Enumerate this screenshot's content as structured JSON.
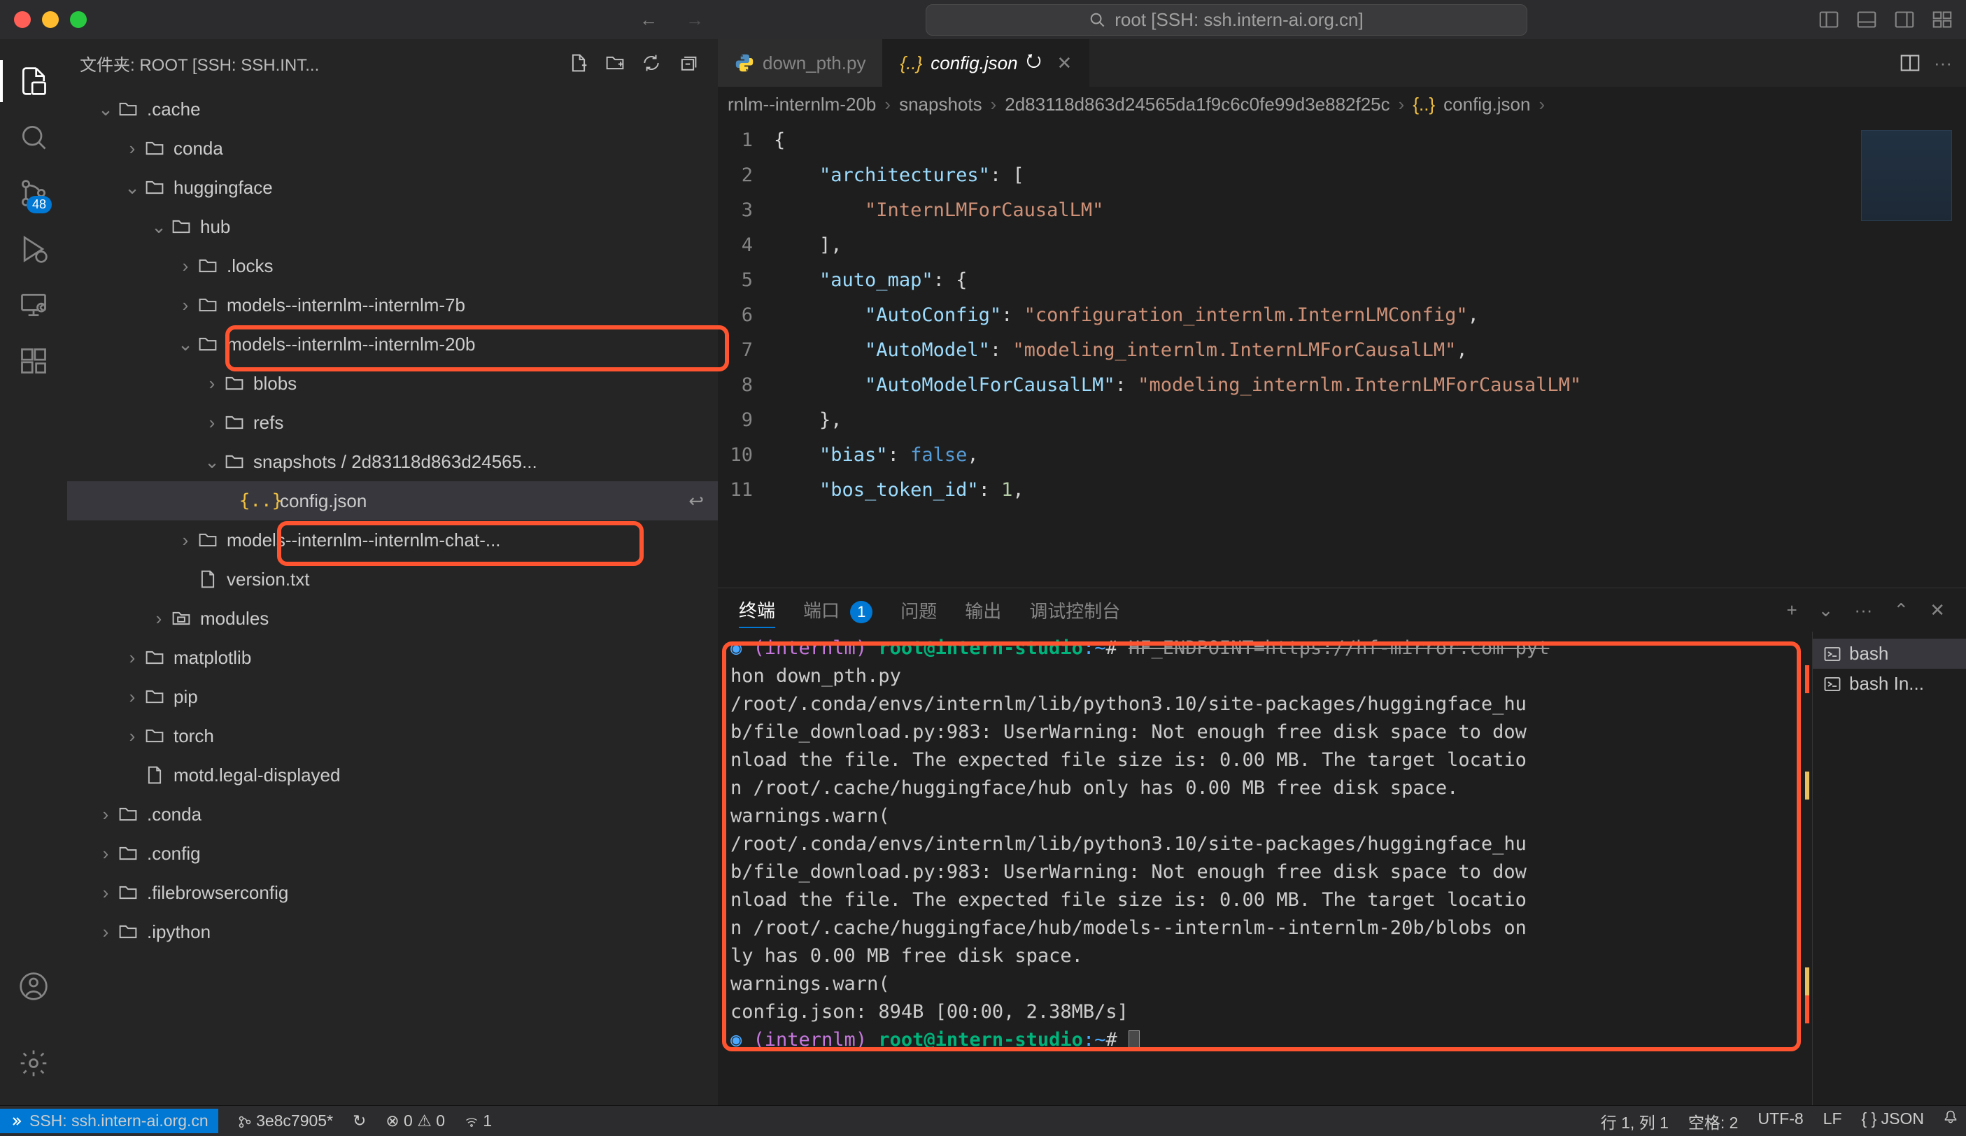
{
  "titlebar": {
    "title": "root [SSH: ssh.intern-ai.org.cn]"
  },
  "activity": {
    "badge": "48"
  },
  "sidebar": {
    "header": "文件夹: ROOT [SSH: SSH.INT...",
    "tree": [
      {
        "indent": 0,
        "chev": "down",
        "icon": "folder-open",
        "label": ".cache"
      },
      {
        "indent": 1,
        "chev": "right",
        "icon": "folder",
        "label": "conda"
      },
      {
        "indent": 1,
        "chev": "down",
        "icon": "folder-open",
        "label": "huggingface"
      },
      {
        "indent": 2,
        "chev": "down",
        "icon": "folder-open",
        "label": "hub"
      },
      {
        "indent": 3,
        "chev": "right",
        "icon": "folder",
        "label": ".locks"
      },
      {
        "indent": 3,
        "chev": "right",
        "icon": "folder",
        "label": "models--internlm--internlm-7b"
      },
      {
        "indent": 3,
        "chev": "down",
        "icon": "folder-open",
        "label": "models--internlm--internlm-20b"
      },
      {
        "indent": 4,
        "chev": "right",
        "icon": "folder",
        "label": "blobs"
      },
      {
        "indent": 4,
        "chev": "right",
        "icon": "folder",
        "label": "refs"
      },
      {
        "indent": 4,
        "chev": "down",
        "icon": "folder-open",
        "label": "snapshots / 2d83118d863d24565..."
      },
      {
        "indent": 5,
        "chev": "",
        "icon": "json",
        "label": "config.json",
        "selected": true,
        "return": true
      },
      {
        "indent": 3,
        "chev": "right",
        "icon": "folder",
        "label": "models--internlm--internlm-chat-..."
      },
      {
        "indent": 3,
        "chev": "",
        "icon": "file",
        "label": "version.txt"
      },
      {
        "indent": 2,
        "chev": "right",
        "icon": "folder-modules",
        "label": "modules"
      },
      {
        "indent": 1,
        "chev": "right",
        "icon": "folder",
        "label": "matplotlib"
      },
      {
        "indent": 1,
        "chev": "right",
        "icon": "folder",
        "label": "pip"
      },
      {
        "indent": 1,
        "chev": "right",
        "icon": "folder",
        "label": "torch"
      },
      {
        "indent": 1,
        "chev": "",
        "icon": "file",
        "label": "motd.legal-displayed"
      },
      {
        "indent": 0,
        "chev": "right",
        "icon": "folder",
        "label": ".conda"
      },
      {
        "indent": 0,
        "chev": "right",
        "icon": "folder",
        "label": ".config"
      },
      {
        "indent": 0,
        "chev": "right",
        "icon": "folder",
        "label": ".filebrowserconfig"
      },
      {
        "indent": 0,
        "chev": "right",
        "icon": "folder",
        "label": ".ipython"
      }
    ]
  },
  "editor": {
    "tabs": [
      {
        "icon": "python",
        "label": "down_pth.py",
        "active": false,
        "dirty": false
      },
      {
        "icon": "json",
        "label": "config.json",
        "active": true,
        "dirty": true,
        "italic": true
      }
    ],
    "breadcrumbs": [
      "rnlm--internlm-20b",
      "snapshots",
      "2d83118d863d24565da1f9c6c0fe99d3e882f25c",
      "config.json"
    ],
    "code": {
      "lines": [
        {
          "n": 1,
          "seg": [
            {
              "c": "brace",
              "t": "{"
            }
          ]
        },
        {
          "n": 2,
          "seg": [
            {
              "c": "plain",
              "t": "    "
            },
            {
              "c": "key",
              "t": "\"architectures\""
            },
            {
              "c": "plain",
              "t": ": ["
            }
          ]
        },
        {
          "n": 3,
          "seg": [
            {
              "c": "plain",
              "t": "        "
            },
            {
              "c": "str",
              "t": "\"InternLMForCausalLM\""
            }
          ]
        },
        {
          "n": 4,
          "seg": [
            {
              "c": "plain",
              "t": "    ],"
            }
          ]
        },
        {
          "n": 5,
          "seg": [
            {
              "c": "plain",
              "t": "    "
            },
            {
              "c": "key",
              "t": "\"auto_map\""
            },
            {
              "c": "plain",
              "t": ": {"
            }
          ]
        },
        {
          "n": 6,
          "seg": [
            {
              "c": "plain",
              "t": "        "
            },
            {
              "c": "key",
              "t": "\"AutoConfig\""
            },
            {
              "c": "plain",
              "t": ": "
            },
            {
              "c": "str",
              "t": "\"configuration_internlm.InternLMConfig\""
            },
            {
              "c": "plain",
              "t": ","
            }
          ]
        },
        {
          "n": 7,
          "seg": [
            {
              "c": "plain",
              "t": "        "
            },
            {
              "c": "key",
              "t": "\"AutoModel\""
            },
            {
              "c": "plain",
              "t": ": "
            },
            {
              "c": "str",
              "t": "\"modeling_internlm.InternLMForCausalLM\""
            },
            {
              "c": "plain",
              "t": ","
            }
          ]
        },
        {
          "n": 8,
          "seg": [
            {
              "c": "plain",
              "t": "        "
            },
            {
              "c": "key",
              "t": "\"AutoModelForCausalLM\""
            },
            {
              "c": "plain",
              "t": ": "
            },
            {
              "c": "str",
              "t": "\"modeling_internlm.InternLMForCausalLM\""
            }
          ]
        },
        {
          "n": 9,
          "seg": [
            {
              "c": "plain",
              "t": "    },"
            }
          ]
        },
        {
          "n": 10,
          "seg": [
            {
              "c": "plain",
              "t": "    "
            },
            {
              "c": "key",
              "t": "\"bias\""
            },
            {
              "c": "plain",
              "t": ": "
            },
            {
              "c": "kw",
              "t": "false"
            },
            {
              "c": "plain",
              "t": ","
            }
          ]
        },
        {
          "n": 11,
          "seg": [
            {
              "c": "plain",
              "t": "    "
            },
            {
              "c": "key",
              "t": "\"bos_token_id\""
            },
            {
              "c": "plain",
              "t": ": "
            },
            {
              "c": "num",
              "t": "1"
            },
            {
              "c": "plain",
              "t": ","
            }
          ]
        }
      ]
    }
  },
  "panel": {
    "tabs": {
      "terminal": "终端",
      "ports": "端口",
      "badge": "1",
      "problems": "问题",
      "output": "输出",
      "debug": "调试控制台"
    },
    "terminal_sessions": [
      {
        "label": "bash",
        "active": true
      },
      {
        "label": "bash In..."
      }
    ],
    "lines": [
      {
        "t": "prompt1",
        "env": "(internlm) ",
        "user": "root@intern-studio",
        "path": ":~",
        "hash": "# ",
        "cmd": "HF_ENDPOINT=https://hf-mirror.com pyt"
      },
      {
        "t": "plain",
        "txt": "hon down_pth.py"
      },
      {
        "t": "plain",
        "txt": "/root/.conda/envs/internlm/lib/python3.10/site-packages/huggingface_hu"
      },
      {
        "t": "plain",
        "txt": "b/file_download.py:983: UserWarning: Not enough free disk space to dow"
      },
      {
        "t": "plain",
        "txt": "nload the file. The expected file size is: 0.00 MB. The target locatio"
      },
      {
        "t": "plain",
        "txt": "n /root/.cache/huggingface/hub only has 0.00 MB free disk space."
      },
      {
        "t": "plain",
        "txt": "  warnings.warn("
      },
      {
        "t": "plain",
        "txt": "/root/.conda/envs/internlm/lib/python3.10/site-packages/huggingface_hu"
      },
      {
        "t": "plain",
        "txt": "b/file_download.py:983: UserWarning: Not enough free disk space to dow"
      },
      {
        "t": "plain",
        "txt": "nload the file. The expected file size is: 0.00 MB. The target locatio"
      },
      {
        "t": "plain",
        "txt": "n /root/.cache/huggingface/hub/models--internlm--internlm-20b/blobs on"
      },
      {
        "t": "plain",
        "txt": "ly has 0.00 MB free disk space."
      },
      {
        "t": "plain",
        "txt": "  warnings.warn("
      },
      {
        "t": "plain",
        "txt": "config.json: 894B [00:00, 2.38MB/s]"
      },
      {
        "t": "prompt2",
        "bullet": "◉ ",
        "env": "(internlm) ",
        "user": "root@intern-studio",
        "path": ":~",
        "hash": "# "
      }
    ]
  },
  "statusbar": {
    "remote": "SSH: ssh.intern-ai.org.cn",
    "branch": "3e8c7905*",
    "sync": "↻",
    "errors": "0",
    "warnings": "0",
    "radio": "1",
    "ln": "行 1, 列 1",
    "spaces": "空格: 2",
    "encoding": "UTF-8",
    "eol": "LF",
    "lang": "JSON"
  }
}
